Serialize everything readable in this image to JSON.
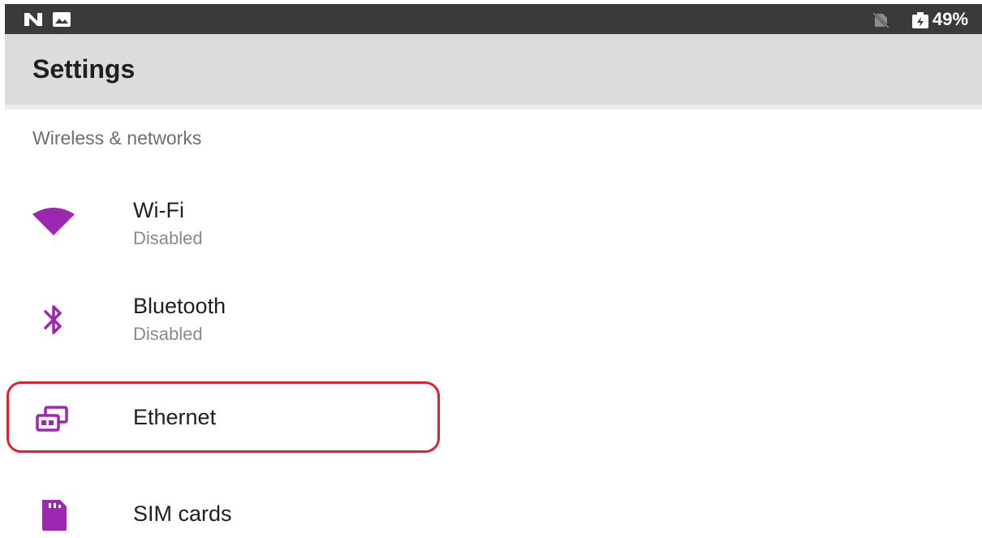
{
  "status_bar": {
    "left_icons": [
      "n-notification-icon",
      "image-notification-icon"
    ],
    "right_icons": [
      "no-sim-icon",
      "battery-charging-icon"
    ],
    "battery_text": "49%"
  },
  "app_bar": {
    "title": "Settings"
  },
  "section": {
    "header": "Wireless & networks"
  },
  "items": [
    {
      "title": "Wi-Fi",
      "subtitle": "Disabled",
      "icon": "wifi-icon"
    },
    {
      "title": "Bluetooth",
      "subtitle": "Disabled",
      "icon": "bluetooth-icon"
    },
    {
      "title": "Ethernet",
      "icon": "ethernet-icon"
    },
    {
      "title": "SIM cards",
      "icon": "sim-card-icon"
    }
  ],
  "colors": {
    "accent": "#9c27b0",
    "status_bar": "#3a3a3a",
    "app_bar": "#dcdcdc",
    "highlight": "#e0202e"
  }
}
